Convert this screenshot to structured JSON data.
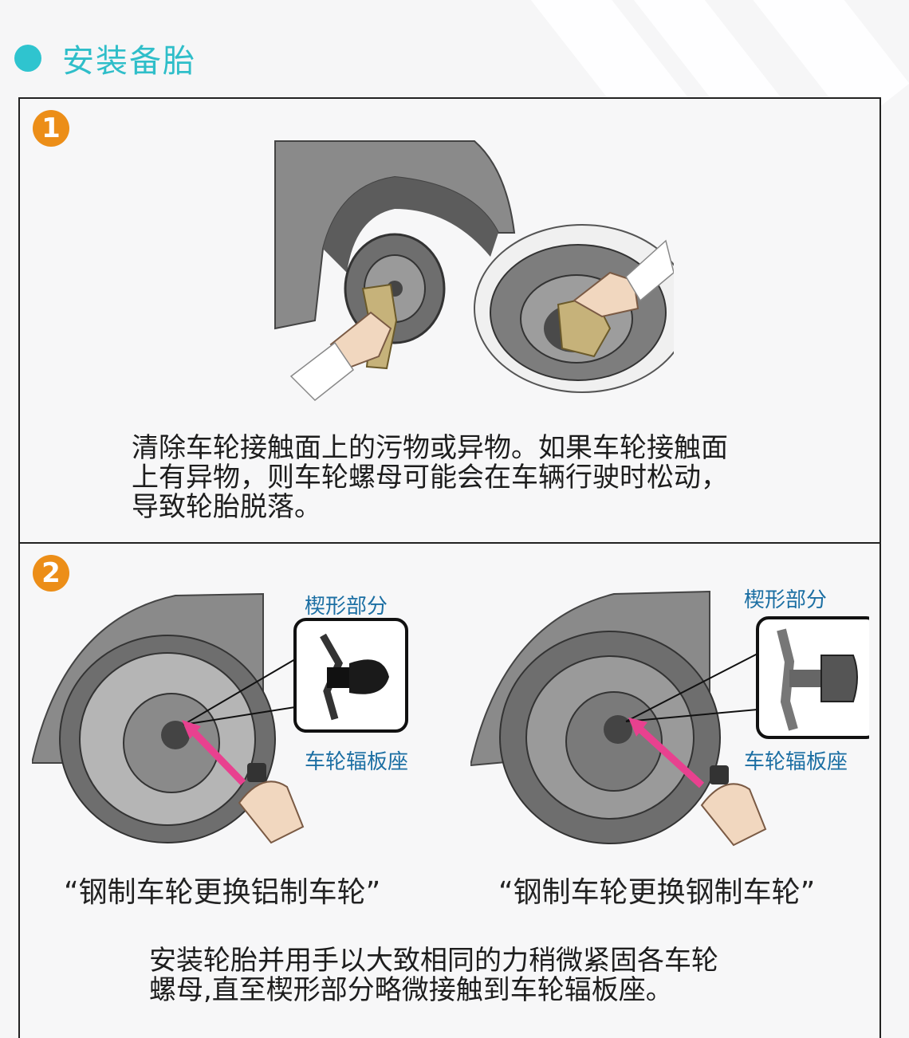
{
  "header": {
    "title": "安装备胎"
  },
  "steps": [
    {
      "number": "1",
      "description": [
        "清除车轮接触面上的污物或异物。如果车轮接触面",
        "上有异物，则车轮螺母可能会在车辆行驶时松动，",
        "导致轮胎脱落。"
      ]
    },
    {
      "number": "2",
      "figures": [
        {
          "caption": "“钢制车轮更换铝制车轮”",
          "label_top": "楔形部分",
          "label_bottom": "车轮辐板座"
        },
        {
          "caption": "“钢制车轮更换钢制车轮”",
          "label_top": "楔形部分",
          "label_bottom": "车轮辐板座"
        }
      ],
      "description": [
        "安装轮胎并用手以大致相同的力稍微紧固各车轮",
        "螺母,直至楔形部分略微接触到车轮辐板座。"
      ]
    }
  ],
  "colors": {
    "accent": "#2fc4cf",
    "step_badge": "#ec8e18",
    "arrow": "#e8418f",
    "label": "#1c6fa3"
  }
}
